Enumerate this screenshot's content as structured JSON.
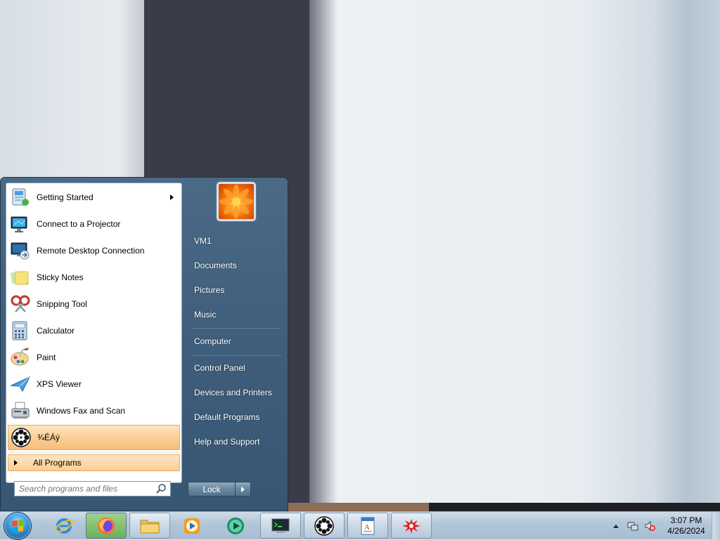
{
  "start_menu": {
    "programs": [
      {
        "label": "Getting Started",
        "icon": "getting-started-icon",
        "has_submenu": true
      },
      {
        "label": "Connect to a Projector",
        "icon": "projector-icon"
      },
      {
        "label": "Remote Desktop Connection",
        "icon": "remote-desktop-icon"
      },
      {
        "label": "Sticky Notes",
        "icon": "sticky-notes-icon"
      },
      {
        "label": "Snipping Tool",
        "icon": "snipping-tool-icon"
      },
      {
        "label": "Calculator",
        "icon": "calculator-icon"
      },
      {
        "label": "Paint",
        "icon": "paint-icon"
      },
      {
        "label": "XPS Viewer",
        "icon": "xps-viewer-icon"
      },
      {
        "label": "Windows Fax and Scan",
        "icon": "fax-scan-icon"
      },
      {
        "label": "¾ÉÁý",
        "icon": "film-reel-icon",
        "highlighted": true
      }
    ],
    "all_programs_label": "All Programs",
    "search_placeholder": "Search programs and files",
    "right_items": {
      "user": "VM1",
      "documents": "Documents",
      "pictures": "Pictures",
      "music": "Music",
      "computer": "Computer",
      "control_panel": "Control Panel",
      "devices_printers": "Devices and Printers",
      "default_programs": "Default Programs",
      "help_support": "Help and Support"
    },
    "shutdown_label": "Lock",
    "user_picture": "flower-avatar-icon"
  },
  "taskbar": {
    "pinned": [
      {
        "icon": "internet-explorer-icon"
      },
      {
        "icon": "firefox-icon",
        "active": true
      },
      {
        "icon": "file-explorer-icon"
      },
      {
        "icon": "media-player-icon"
      },
      {
        "icon": "media-center-icon"
      },
      {
        "icon": "terminal-app-icon"
      },
      {
        "icon": "film-reel-icon"
      },
      {
        "icon": "wordpad-icon"
      },
      {
        "icon": "red-splash-app-icon"
      }
    ],
    "clock": {
      "time": "3:07 PM",
      "date": "4/26/2024"
    }
  },
  "colors": {
    "highlight": "#fbcf95",
    "start_menu_bg": "#3f5e7c",
    "taskbar_bg": "#b3c7d9",
    "wallpaper_dark": "#3b3c4a"
  }
}
